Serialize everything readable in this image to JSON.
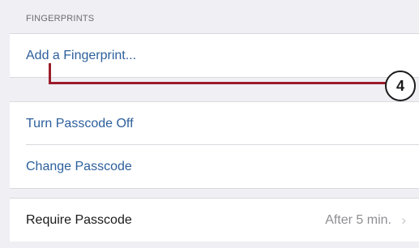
{
  "fingerprints_section": {
    "header": "FINGERPRINTS",
    "add_fingerprint": "Add a Fingerprint..."
  },
  "passcode_section": {
    "turn_off": "Turn Passcode Off",
    "change": "Change Passcode"
  },
  "require_section": {
    "label": "Require Passcode",
    "value": "After 5 min."
  },
  "callout": {
    "number": "4"
  },
  "colors": {
    "link": "#2d5f9c",
    "callout_line": "#9c1c2a",
    "group_background": "#efeff4"
  }
}
